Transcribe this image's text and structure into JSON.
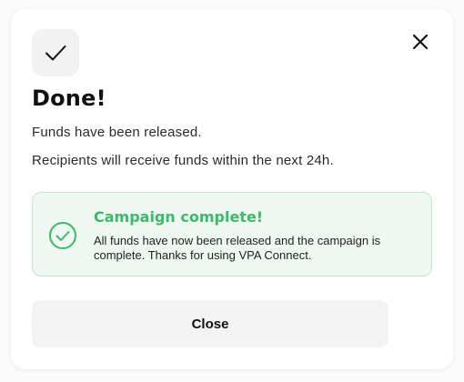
{
  "dialog": {
    "icon": "checkmark-icon",
    "close_icon": "close-icon",
    "title": "Done!",
    "message_line_1": "Funds have been released.",
    "message_line_2": "Recipients will receive funds within the next 24h."
  },
  "notice": {
    "icon": "check-circle-icon",
    "title": "Campaign complete!",
    "body": "All funds have now been released and the campaign is complete. Thanks for using VPA Connect."
  },
  "actions": {
    "close_label": "Close"
  },
  "colors": {
    "success_green": "#3cb96a",
    "notice_background": "#eef8f1",
    "notice_border": "#bfe6cc",
    "button_background": "#f3f3f3"
  }
}
